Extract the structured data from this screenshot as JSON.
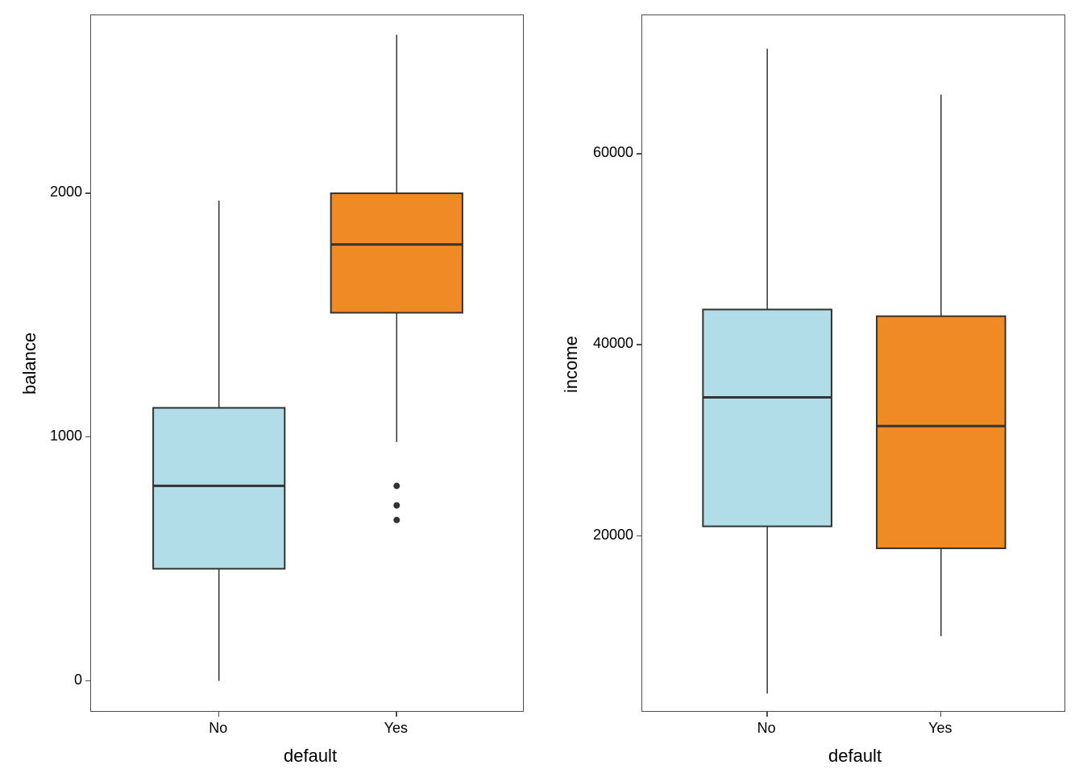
{
  "chart_data": [
    {
      "type": "boxplot",
      "panel": "left",
      "xlabel": "default",
      "ylabel": "balance",
      "categories": [
        "No",
        "Yes"
      ],
      "colors": {
        "No": "#B0DDE8",
        "Yes": "#F08A24"
      },
      "y_ticks": [
        0,
        1000,
        2000
      ],
      "y_range": [
        -130,
        2730
      ],
      "series": [
        {
          "name": "No",
          "min": 0,
          "q1": 460,
          "median": 800,
          "q3": 1120,
          "max": 1970,
          "outliers": []
        },
        {
          "name": "Yes",
          "min": 980,
          "q1": 1510,
          "median": 1790,
          "q3": 2000,
          "max": 2650,
          "outliers": [
            800,
            720,
            660
          ]
        }
      ]
    },
    {
      "type": "boxplot",
      "panel": "right",
      "xlabel": "default",
      "ylabel": "income",
      "categories": [
        "No",
        "Yes"
      ],
      "colors": {
        "No": "#B0DDE8",
        "Yes": "#F08A24"
      },
      "y_ticks": [
        20000,
        40000,
        60000
      ],
      "y_range": [
        1500,
        74500
      ],
      "series": [
        {
          "name": "No",
          "min": 3500,
          "q1": 21000,
          "median": 34500,
          "q3": 43700,
          "max": 71000,
          "outliers": []
        },
        {
          "name": "Yes",
          "min": 9500,
          "q1": 18700,
          "median": 31500,
          "q3": 43000,
          "max": 66200,
          "outliers": []
        }
      ]
    }
  ],
  "left": {
    "ylabel": "balance",
    "xlabel": "default",
    "yticks": {
      "t0": "0",
      "t1": "1000",
      "t2": "2000"
    },
    "xticks": {
      "c0": "No",
      "c1": "Yes"
    }
  },
  "right": {
    "ylabel": "income",
    "xlabel": "default",
    "yticks": {
      "t0": "20000",
      "t1": "40000",
      "t2": "60000"
    },
    "xticks": {
      "c0": "No",
      "c1": "Yes"
    }
  }
}
